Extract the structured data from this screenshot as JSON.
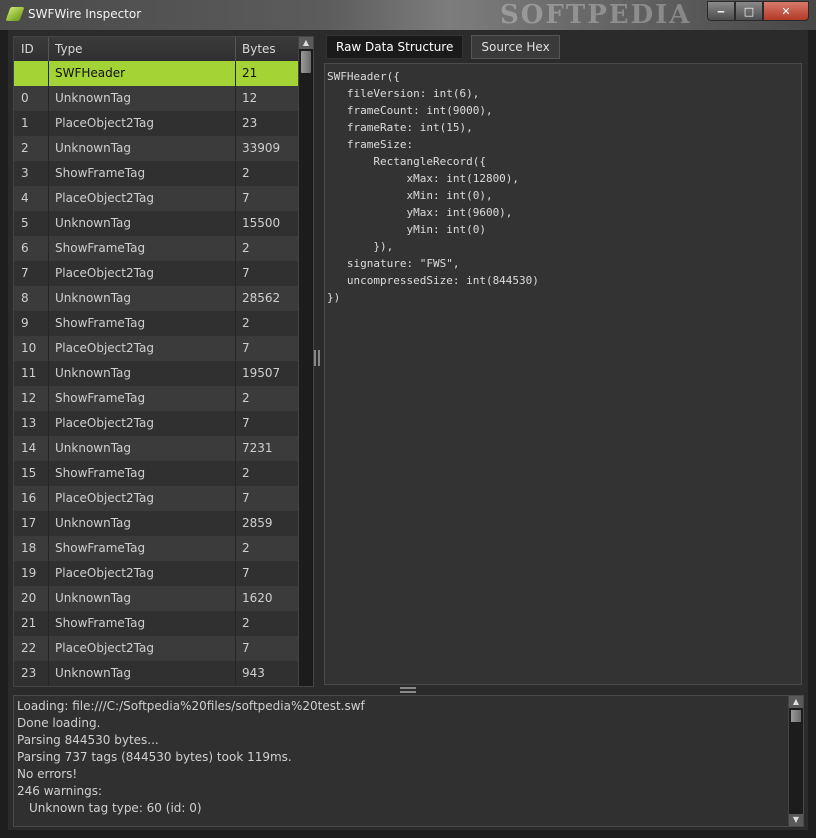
{
  "window": {
    "title": "SWFWire Inspector",
    "watermark": "SOFTPEDIA",
    "minimize_symbol": "‒",
    "maximize_symbol": "□",
    "close_symbol": "✕"
  },
  "tag_table": {
    "headers": {
      "id": "ID",
      "type": "Type",
      "bytes": "Bytes"
    },
    "selected_index": 0,
    "selected_color": "#a4d335",
    "rows": [
      {
        "id": "",
        "type": "SWFHeader",
        "bytes": "21"
      },
      {
        "id": "0",
        "type": "UnknownTag",
        "bytes": "12"
      },
      {
        "id": "1",
        "type": "PlaceObject2Tag",
        "bytes": "23"
      },
      {
        "id": "2",
        "type": "UnknownTag",
        "bytes": "33909"
      },
      {
        "id": "3",
        "type": "ShowFrameTag",
        "bytes": "2"
      },
      {
        "id": "4",
        "type": "PlaceObject2Tag",
        "bytes": "7"
      },
      {
        "id": "5",
        "type": "UnknownTag",
        "bytes": "15500"
      },
      {
        "id": "6",
        "type": "ShowFrameTag",
        "bytes": "2"
      },
      {
        "id": "7",
        "type": "PlaceObject2Tag",
        "bytes": "7"
      },
      {
        "id": "8",
        "type": "UnknownTag",
        "bytes": "28562"
      },
      {
        "id": "9",
        "type": "ShowFrameTag",
        "bytes": "2"
      },
      {
        "id": "10",
        "type": "PlaceObject2Tag",
        "bytes": "7"
      },
      {
        "id": "11",
        "type": "UnknownTag",
        "bytes": "19507"
      },
      {
        "id": "12",
        "type": "ShowFrameTag",
        "bytes": "2"
      },
      {
        "id": "13",
        "type": "PlaceObject2Tag",
        "bytes": "7"
      },
      {
        "id": "14",
        "type": "UnknownTag",
        "bytes": "7231"
      },
      {
        "id": "15",
        "type": "ShowFrameTag",
        "bytes": "2"
      },
      {
        "id": "16",
        "type": "PlaceObject2Tag",
        "bytes": "7"
      },
      {
        "id": "17",
        "type": "UnknownTag",
        "bytes": "2859"
      },
      {
        "id": "18",
        "type": "ShowFrameTag",
        "bytes": "2"
      },
      {
        "id": "19",
        "type": "PlaceObject2Tag",
        "bytes": "7"
      },
      {
        "id": "20",
        "type": "UnknownTag",
        "bytes": "1620"
      },
      {
        "id": "21",
        "type": "ShowFrameTag",
        "bytes": "2"
      },
      {
        "id": "22",
        "type": "PlaceObject2Tag",
        "bytes": "7"
      },
      {
        "id": "23",
        "type": "UnknownTag",
        "bytes": "943"
      }
    ]
  },
  "tabs": [
    {
      "label": "Raw Data Structure",
      "active": true
    },
    {
      "label": "Source Hex",
      "active": false
    }
  ],
  "structure_text": "SWFHeader({\n   fileVersion: int(6),\n   frameCount: int(9000),\n   frameRate: int(15),\n   frameSize:\n       RectangleRecord({\n            xMax: int(12800),\n            xMin: int(0),\n            yMax: int(9600),\n            yMin: int(0)\n       }),\n   signature: \"FWS\",\n   uncompressedSize: int(844530)\n})",
  "log": {
    "lines": [
      "Loading: file:///C:/Softpedia%20files/softpedia%20test.swf",
      "Done loading.",
      "Parsing 844530 bytes...",
      "Parsing 737 tags (844530 bytes) took 119ms.",
      "No errors!",
      "246 warnings:",
      "Unknown tag type: 60 (id: 0)"
    ]
  }
}
